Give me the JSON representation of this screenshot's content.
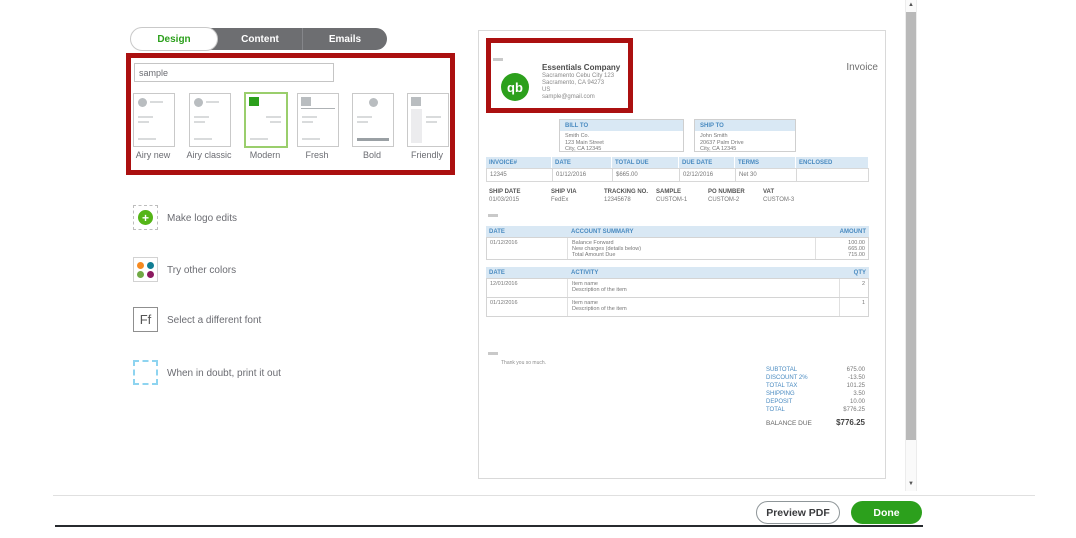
{
  "tabs": {
    "design": "Design",
    "content": "Content",
    "emails": "Emails"
  },
  "sidebar": {
    "template_name_value": "sample",
    "templates": [
      {
        "name": "Airy new"
      },
      {
        "name": "Airy classic"
      },
      {
        "name": "Modern"
      },
      {
        "name": "Fresh"
      },
      {
        "name": "Bold"
      },
      {
        "name": "Friendly"
      }
    ],
    "selected_template": "Modern",
    "options": [
      {
        "label": "Make logo edits",
        "icon": "logo-plus-icon",
        "icon_glyph": "+"
      },
      {
        "label": "Try other colors",
        "icon": "color-dots-icon"
      },
      {
        "label": "Select a different font",
        "icon": "font-icon",
        "icon_text": "Ff"
      },
      {
        "label": "When in doubt, print it out",
        "icon": "print-margins-icon"
      }
    ]
  },
  "invoice": {
    "title": "Invoice",
    "company": {
      "logo_text": "qb",
      "name": "Essentials Company",
      "address1": "Sacramento Cebu City 123",
      "address2": "Sacramento, CA 94273",
      "address3": "US",
      "email": "sample@gmail.com"
    },
    "bill_to": {
      "label": "BILL TO",
      "line1": "Smith Co.",
      "line2": "123 Main Street",
      "line3": "City, CA 12345"
    },
    "ship_to": {
      "label": "SHIP TO",
      "line1": "John Smith",
      "line2": "20637 Palm Drive",
      "line3": "City, CA 12345"
    },
    "meta": {
      "headers": [
        "INVOICE#",
        "DATE",
        "TOTAL DUE",
        "DUE DATE",
        "TERMS",
        "ENCLOSED"
      ],
      "values": [
        "12345",
        "01/12/2016",
        "$665.00",
        "02/12/2016",
        "Net 30",
        ""
      ]
    },
    "ship_row": {
      "headers": [
        "SHIP DATE",
        "SHIP VIA",
        "TRACKING NO.",
        "SAMPLE",
        "PO NUMBER",
        "VAT"
      ],
      "values": [
        "01/03/2015",
        "FedEx",
        "12345678",
        "CUSTOM-1",
        "CUSTOM-2",
        "CUSTOM-3"
      ]
    },
    "account_summary": {
      "headers": [
        "DATE",
        "ACCOUNT SUMMARY",
        "AMOUNT"
      ],
      "date": "01/12/2016",
      "lines": [
        {
          "label": "Balance Forward",
          "amount": "100.00"
        },
        {
          "label": "New charges (details below)",
          "amount": "665.00"
        },
        {
          "label": "Total Amount Due",
          "amount": "715.00"
        }
      ]
    },
    "activity": {
      "headers": [
        "DATE",
        "ACTIVITY",
        "QTY"
      ],
      "rows": [
        {
          "date": "12/01/2016",
          "name": "Item name",
          "description": "Description of the item",
          "qty": "2"
        },
        {
          "date": "01/12/2016",
          "name": "Item name",
          "description": "Description of the item",
          "qty": "1"
        }
      ]
    },
    "message": "Thank you so much.",
    "totals": [
      {
        "label": "SUBTOTAL",
        "value": "675.00"
      },
      {
        "label": "DISCOUNT 2%",
        "value": "-13.50"
      },
      {
        "label": "TOTAL TAX",
        "value": "101.25"
      },
      {
        "label": "SHIPPING",
        "value": "3.50"
      },
      {
        "label": "DEPOSIT",
        "value": "10.00"
      },
      {
        "label": "TOTAL",
        "value": "$776.25"
      }
    ],
    "balance_due": {
      "label": "BALANCE DUE",
      "value": "$776.25"
    }
  },
  "footer": {
    "preview_pdf": "Preview PDF",
    "done": "Done"
  },
  "scrollbar": {
    "up": "▲",
    "down": "▼"
  },
  "colors": {
    "qb_green": "#2ca01c",
    "invoice_blue": "#4a8bc1",
    "table_header_bg": "#d9e8f4",
    "highlight_red": "#ab1010",
    "tab_gray": "#6d6e71",
    "selected_template_border": "#9ace6c"
  }
}
